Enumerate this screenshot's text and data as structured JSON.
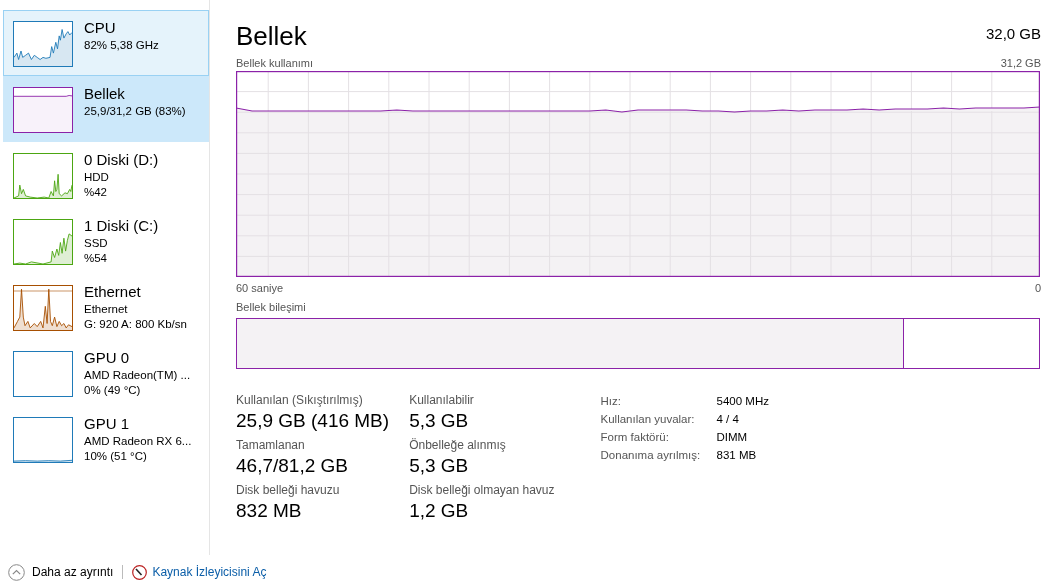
{
  "sidebar": {
    "items": [
      {
        "kind": "cpu",
        "title": "CPU",
        "lines": [
          "82%  5,38 GHz"
        ],
        "color": "#1f7ab8",
        "selected": false,
        "focused": true
      },
      {
        "kind": "memory",
        "title": "Bellek",
        "lines": [
          "25,9/31,2 GB (83%)"
        ],
        "color": "#8b22a8",
        "selected": true,
        "focused": false
      },
      {
        "kind": "disk-d",
        "title": "0 Diski (D:)",
        "lines": [
          "HDD",
          "%42"
        ],
        "color": "#4ca612",
        "selected": false,
        "focused": false
      },
      {
        "kind": "disk-c",
        "title": "1 Diski (C:)",
        "lines": [
          "SSD",
          "%54"
        ],
        "color": "#4ca612",
        "selected": false,
        "focused": false
      },
      {
        "kind": "network",
        "title": "Ethernet",
        "lines": [
          "Ethernet",
          "G: 920  A: 800 Kb/sn"
        ],
        "color": "#a74f01",
        "selected": false,
        "focused": false
      },
      {
        "kind": "gpu-idle",
        "title": "GPU 0",
        "lines": [
          "AMD Radeon(TM) ...",
          "0%  (49 °C)"
        ],
        "color": "#1f7ab8",
        "selected": false,
        "focused": false
      },
      {
        "kind": "gpu-low",
        "title": "GPU 1",
        "lines": [
          "AMD Radeon RX 6...",
          "10%  (51 °C)"
        ],
        "color": "#1f7ab8",
        "selected": false,
        "focused": false
      }
    ]
  },
  "main": {
    "title": "Bellek",
    "total": "32,0 GB",
    "usage_chart": {
      "label": "Bellek kullanımı",
      "max": "31,2 GB",
      "time_start": "60 saniye",
      "time_end": "0"
    },
    "composition": {
      "label": "Bellek bileşimi",
      "level": 0.83
    },
    "stats": [
      {
        "label": "Kullanılan (Sıkıştırılmış)",
        "value": "25,9 GB (416 MB)"
      },
      {
        "label": "Kullanılabilir",
        "value": "5,3 GB"
      },
      {
        "label": "Tamamlanan",
        "value": "46,7/81,2 GB"
      },
      {
        "label": "Önbelleğe alınmış",
        "value": "5,3 GB"
      },
      {
        "label": "Disk belleği havuzu",
        "value": "832 MB"
      },
      {
        "label": "Disk belleği olmayan havuz",
        "value": "1,2 GB"
      }
    ],
    "details": [
      {
        "label": "Hız:",
        "value": "5400 MHz"
      },
      {
        "label": "Kullanılan yuvalar:",
        "value": "4 / 4"
      },
      {
        "label": "Form faktörü:",
        "value": "DIMM"
      },
      {
        "label": "Donanıma ayrılmış:",
        "value": "831 MB"
      }
    ]
  },
  "footer": {
    "less_details": "Daha az ayrıntı",
    "resource_monitor": "Kaynak İzleyicisini Aç"
  }
}
